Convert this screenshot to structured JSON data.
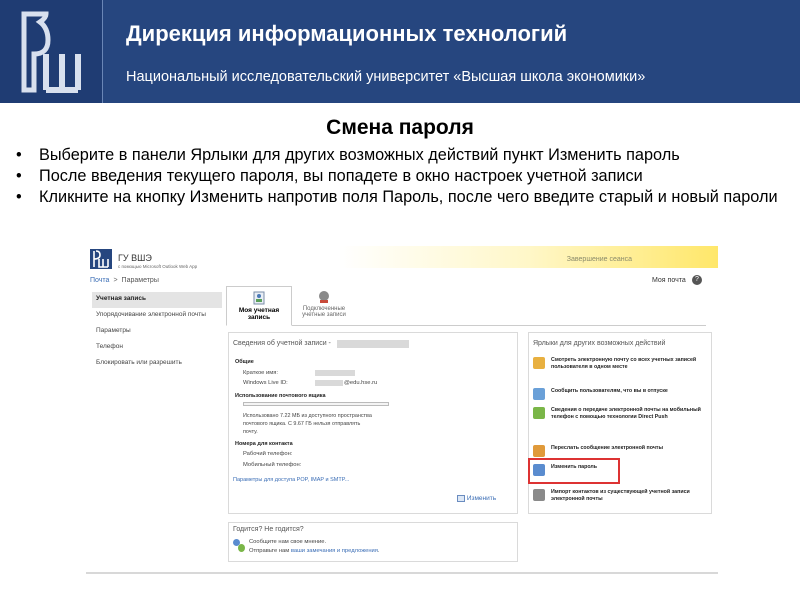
{
  "slide": {
    "header_title": "Дирекция информационных технологий",
    "header_subtitle": "Национальный исследовательский университет «Высшая школа экономики»",
    "title": "Смена пароля",
    "bullets": [
      "Выберите в панели Ярлыки для других возможных действий пункт Изменить пароль",
      "После введения текущего пароля, вы попадете в окно настроек учетной записи",
      "Кликните на кнопку Изменить напротив поля Пароль, после чего введите старый и новый пароли"
    ],
    "colors": {
      "header_bg": "#26467f",
      "highlight": "#dd3333"
    }
  },
  "owa": {
    "app_name": "ГУ ВШЭ",
    "app_sub": "с помощью Microsoft Outlook Web App",
    "session_end": "Завершение сеанса",
    "breadcrumb": {
      "mail": "Почта",
      "sep": ">",
      "current": "Параметры"
    },
    "my_mail": "Моя почта",
    "help_icon": "?",
    "nav": [
      "Учетная запись",
      "Упорядочивание электронной почты",
      "Параметры",
      "Телефон",
      "Блокировать или разрешить"
    ],
    "tabs": {
      "account": "Моя учетная запись",
      "connected_1": "Подключенные",
      "connected_2": "учетные записи"
    },
    "account_panel": {
      "title": "Сведения об учетной записи -",
      "general": "Общие",
      "short_name_label": "Краткое имя:",
      "live_id_label": "Windows Live ID:",
      "live_id_value": "@edu.hse.ru",
      "mailbox_usage": "Использование почтового ящика",
      "usage_1": "Использовано 7.22 МБ из доступного пространства",
      "usage_2": "почтового ящика. С 9.67 ГБ нельзя отправлять",
      "usage_3": "почту.",
      "contact_numbers": "Номера для контакта",
      "work_phone": "Рабочий телефон:",
      "mobile_phone": "Мобильный телефон:",
      "pop_link": "Параметры для доступа POP, IMAP и SMTP...",
      "edit": "Изменить"
    },
    "shortcuts": {
      "title": "Ярлыки для других возможных действий",
      "items": [
        {
          "text": "Смотреть электронную почту со всех учетных записей пользователя в одном месте",
          "icon": "folder-icon",
          "color": "#e8b040"
        },
        {
          "text": "Сообщить пользователям, что вы в отпуске",
          "icon": "vacation-icon",
          "color": "#6aa0d8"
        },
        {
          "text": "Сведения о передаче электронной почты на мобильный телефон с помощью технологии Direct Push",
          "icon": "mobile-icon",
          "color": "#7ab648"
        },
        {
          "text": "Переслать сообщение электронной почты",
          "icon": "forward-icon",
          "color": "#e09a3a"
        },
        {
          "text": "Изменить пароль",
          "icon": "password-icon",
          "color": "#5a8ccf"
        },
        {
          "text": "Импорт контактов из существующей учетной записи электронной почты",
          "icon": "import-icon",
          "color": "#8a8a8a"
        }
      ]
    },
    "feedback": {
      "title": "Годится? Не годится?",
      "line1": "Сообщите нам свое мнение.",
      "line2_prefix": "Отправьте нам",
      "line2_link": "ваши замечания и предложения",
      "line2_suffix": "."
    }
  }
}
